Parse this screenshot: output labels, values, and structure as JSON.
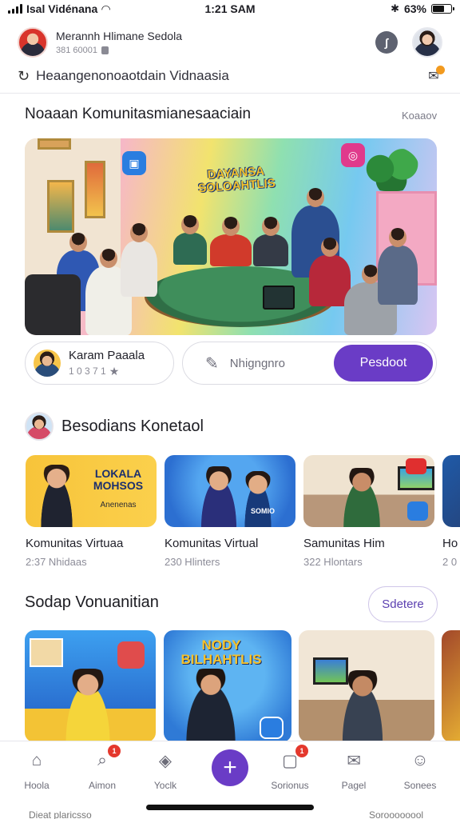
{
  "status": {
    "carrier": "Isal Vidénana",
    "time": "1:21 SAM",
    "battery": "63%",
    "battery_level": 0.63
  },
  "header": {
    "name": "Merannh Hlimane Sedola",
    "sub": "381 60001",
    "location": "Heaangenonoaotdain Vidnaasia"
  },
  "featured": {
    "title": "Noaaan Komunitasmianesaaciain",
    "link": "Koaaov",
    "art_title": "DAYANSA SOLOAHTLIS"
  },
  "profile_pill": {
    "name": "Karam Paaala",
    "sub": "1 0 3 7 1"
  },
  "composer": {
    "placeholder": "Nhigngnro",
    "button": "Pesdoot"
  },
  "section2": {
    "title": "Besodians Konetaol",
    "cards": [
      {
        "title": "Komunitas Virtuaa",
        "sub": "2:37 Nhidaas",
        "art": "LOKALA MOHSOS",
        "art_sub": "Anenenas"
      },
      {
        "title": "Komunitas Virtual",
        "sub": "230 Hlinters",
        "art": "SOMIO"
      },
      {
        "title": "Samunitas Him",
        "sub": "322 Hlontars"
      },
      {
        "title": "Ho",
        "sub": "2 0"
      }
    ]
  },
  "section3": {
    "title": "Sodap Vonuanitian",
    "button": "Sdetere",
    "art": "NODY BILHAHTLIS"
  },
  "nav": [
    {
      "label": "Hoola",
      "icon": "home-icon"
    },
    {
      "label": "Aimon",
      "icon": "search-icon",
      "badge": "1"
    },
    {
      "label": "Yoclk",
      "icon": "shield-icon"
    },
    {
      "label": "Sorionus",
      "icon": "chat-icon",
      "badge": "1"
    },
    {
      "label": "Pagel",
      "icon": "message-icon"
    },
    {
      "label": "Sonees",
      "icon": "profile-icon"
    }
  ],
  "bottom_cut": {
    "left": "Dieat plaricsso",
    "right": "Soroooooool"
  }
}
